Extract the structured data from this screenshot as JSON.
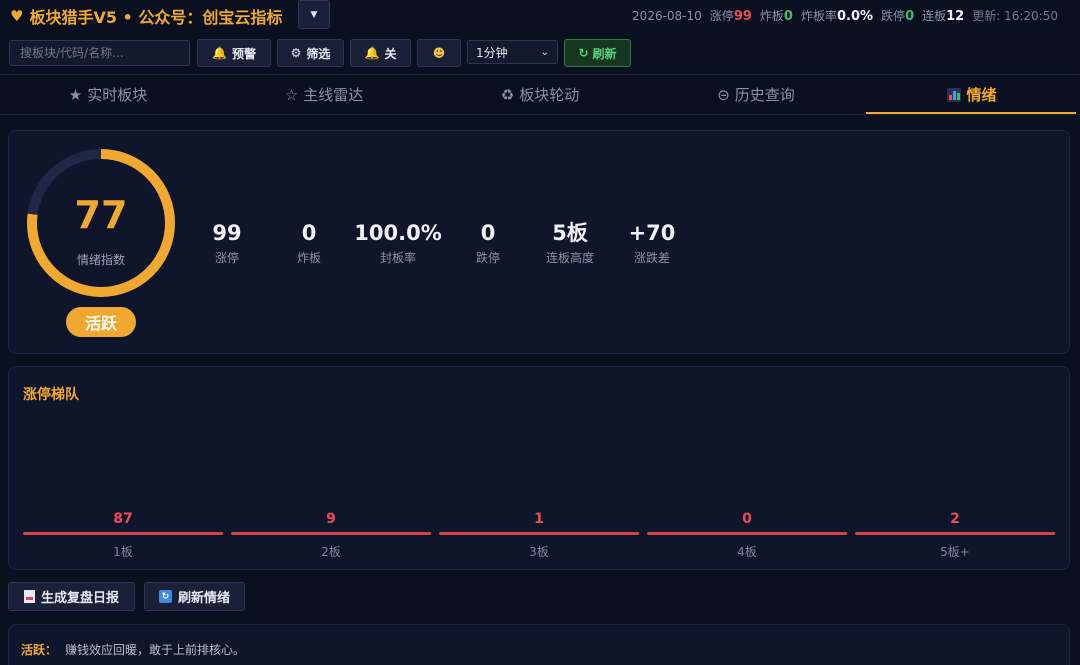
{
  "header": {
    "title": "板块猎手V5 • 公众号：创宝云指标",
    "date": "2026-08-10",
    "stats": [
      {
        "label": "涨停",
        "value": "99",
        "color": "#f04a55"
      },
      {
        "label": "炸板",
        "value": "0",
        "color": "#38c06a"
      },
      {
        "label": "炸板率",
        "value": "0.0%",
        "color": "#f4f6fb"
      },
      {
        "label": "跌停",
        "value": "0",
        "color": "#38c06a"
      },
      {
        "label": "连板",
        "value": "12",
        "color": "#f4f6fb"
      }
    ],
    "update_label": "更新:",
    "update_time": "16:20:50"
  },
  "toolbar": {
    "search_placeholder": "搜板块/代码/名称...",
    "alert_label": "预警",
    "filter_label": "筛选",
    "off_label": "关",
    "interval": "1分钟",
    "refresh_label": "刷新"
  },
  "tabs": [
    {
      "icon": "★",
      "label": "实时板块"
    },
    {
      "icon": "☆",
      "label": "主线雷达"
    },
    {
      "icon": "♻",
      "label": "板块轮动"
    },
    {
      "icon": "⊝",
      "label": "历史查询"
    },
    {
      "icon": "",
      "label": "情绪"
    }
  ],
  "sentiment": {
    "index": "77",
    "index_value": 77,
    "index_max": 100,
    "index_label": "情绪指数",
    "badge": "活跃",
    "accent": "#f0a830",
    "kpis": [
      {
        "value": "99",
        "label": "涨停"
      },
      {
        "value": "0",
        "label": "炸板"
      },
      {
        "value": "100.0%",
        "label": "封板率"
      },
      {
        "value": "0",
        "label": "跌停"
      },
      {
        "value": "5板",
        "label": "连板高度"
      },
      {
        "value": "+70",
        "label": "涨跌差"
      }
    ]
  },
  "ladder": {
    "title": "涨停梯队",
    "rungs": [
      {
        "value": "87",
        "label": "1板"
      },
      {
        "value": "9",
        "label": "2板"
      },
      {
        "value": "1",
        "label": "3板"
      },
      {
        "value": "0",
        "label": "4板"
      },
      {
        "value": "2",
        "label": "5板+"
      }
    ]
  },
  "actions": {
    "report_label": "生成复盘日报",
    "refresh_mood_label": "刷新情绪"
  },
  "comment": {
    "key": "活跃：",
    "text": "赚钱效应回暖，敢于上前排核心。"
  }
}
